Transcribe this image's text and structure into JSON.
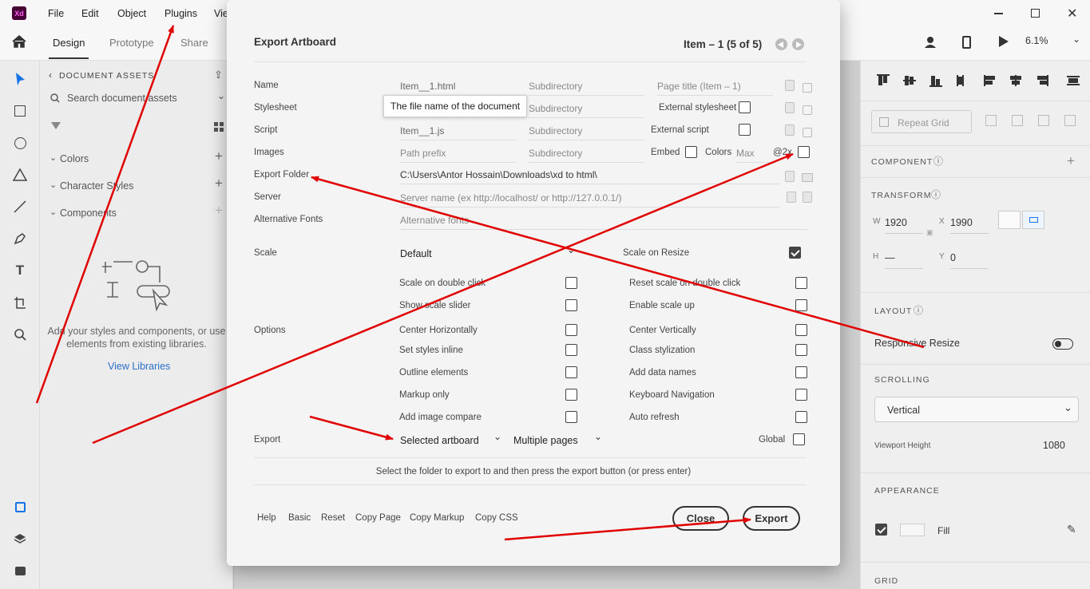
{
  "app": {
    "logo": "Xd",
    "menus": [
      "File",
      "Edit",
      "Object",
      "Plugins",
      "Vie"
    ],
    "window_controls": [
      "minimize-icon",
      "restore-icon",
      "close-icon"
    ]
  },
  "mode_tabs": {
    "design": "Design",
    "prototype": "Prototype",
    "share": "Share"
  },
  "zoom": "6.1%",
  "assets": {
    "title": "DOCUMENT ASSETS",
    "search_placeholder": "Search document assets",
    "sections": [
      "Colors",
      "Character Styles",
      "Components"
    ],
    "empty_text_1": "Add your styles and components, or use",
    "empty_text_2": "elements from existing libraries.",
    "view_libraries": "View Libraries"
  },
  "right_panel": {
    "repeat_grid": "Repeat Grid",
    "component": "COMPONENT",
    "transform": "TRANSFORM",
    "w_label": "W",
    "w_value": "1920",
    "x_label": "X",
    "x_value": "1990",
    "h_label": "H",
    "h_value": "—",
    "y_label": "Y",
    "y_value": "0",
    "layout": "LAYOUT",
    "responsive_resize": "Responsive Resize",
    "scrolling": "SCROLLING",
    "scroll_value": "Vertical",
    "viewport_height_label": "Viewport Height",
    "viewport_height_value": "1080",
    "appearance": "APPEARANCE",
    "fill_label": "Fill",
    "grid": "GRID"
  },
  "dialog": {
    "title": "Export Artboard",
    "item_nav": "Item – 1 (5 of 5)",
    "rows": {
      "name": {
        "label": "Name",
        "file": "Item__1.html",
        "subdir": "Subdirectory",
        "page_title": "Page title (Item – 1)"
      },
      "stylesheet": {
        "label": "Stylesheet",
        "subdir": "Subdirectory",
        "external": "External stylesheet"
      },
      "script": {
        "label": "Script",
        "file": "Item__1.js",
        "subdir": "Subdirectory",
        "external": "External script"
      },
      "images": {
        "label": "Images",
        "prefix": "Path prefix",
        "subdir": "Subdirectory",
        "embed": "Embed",
        "colors": "Colors",
        "max": "Max",
        "scale": "@2x"
      },
      "export_folder": {
        "label": "Export Folder",
        "value": "C:\\Users\\Antor Hossain\\Downloads\\xd to html\\"
      },
      "server": {
        "label": "Server",
        "placeholder": "Server name (ex http://localhost/ or http://127.0.0.1/)"
      },
      "alt_fonts": {
        "label": "Alternative Fonts",
        "placeholder": "Alternative fonts"
      }
    },
    "tooltip": "The file name of the document",
    "scale": {
      "label": "Scale",
      "value": "Default",
      "on_resize": "Scale on Resize"
    },
    "options_label": "Options",
    "options_left": [
      "Scale on double click",
      "Show scale slider",
      "Center Horizontally",
      "Set styles inline",
      "Outline elements",
      "Markup only",
      "Add image compare"
    ],
    "options_right": [
      "Reset scale on double click",
      "Enable scale up",
      "Center Vertically",
      "Class stylization",
      "Add data names",
      "Keyboard Navigation",
      "Auto refresh"
    ],
    "export": {
      "label": "Export",
      "selection": "Selected artboard",
      "pages": "Multiple pages",
      "global": "Global"
    },
    "hint": "Select the folder to export to and then press the export button (or press enter)",
    "footer_links": [
      "Help",
      "Basic",
      "Reset",
      "Copy Page",
      "Copy Markup",
      "Copy CSS"
    ],
    "close": "Close",
    "export_button": "Export"
  },
  "annotation_color": "#e00000"
}
